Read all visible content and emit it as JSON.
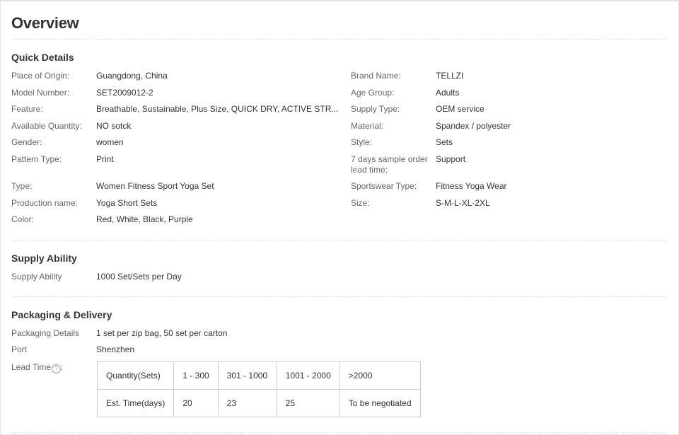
{
  "title": "Overview",
  "quick_details": {
    "heading": "Quick Details",
    "left": [
      {
        "label": "Place of Origin:",
        "value": "Guangdong, China"
      },
      {
        "label": "Model Number:",
        "value": "SET2009012-2"
      },
      {
        "label": "Feature:",
        "value": "Breathable, Sustainable, Plus Size, QUICK DRY, ACTIVE STR..."
      },
      {
        "label": "Available Quantity:",
        "value": "NO sotck"
      },
      {
        "label": "Gender:",
        "value": "women"
      },
      {
        "label": "Pattern Type:",
        "value": "Print"
      },
      {
        "label": "Type:",
        "value": "Women Fitness Sport Yoga Set"
      },
      {
        "label": "Production name:",
        "value": "Yoga Short Sets"
      },
      {
        "label": "Color:",
        "value": "Red, White, Black, Purple"
      }
    ],
    "right": [
      {
        "label": "Brand Name:",
        "value": "TELLZI"
      },
      {
        "label": "Age Group:",
        "value": "Adults"
      },
      {
        "label": "Supply Type:",
        "value": "OEM service"
      },
      {
        "label": "Material:",
        "value": "Spandex / polyester"
      },
      {
        "label": "Style:",
        "value": "Sets"
      },
      {
        "label": "7 days sample order lead time:",
        "value": "Support"
      },
      {
        "label": "Sportswear Type:",
        "value": "Fitness Yoga Wear"
      },
      {
        "label": "Size:",
        "value": "S-M-L-XL-2XL"
      }
    ]
  },
  "supply_ability": {
    "heading": "Supply Ability",
    "label": "Supply Ability",
    "value": "1000 Set/Sets per Day"
  },
  "packaging": {
    "heading": "Packaging & Delivery",
    "details_label": "Packaging Details",
    "details_value": "1 set per zip bag, 50 set per carton",
    "port_label": "Port",
    "port_value": "Shenzhen",
    "lead_label": "Lead Time",
    "lead_suffix": ":",
    "help_icon_glyph": "?",
    "lead_table": {
      "row1": [
        "Quantity(Sets)",
        "1 - 300",
        "301 - 1000",
        "1001 - 2000",
        ">2000"
      ],
      "row2": [
        "Est. Time(days)",
        "20",
        "23",
        "25",
        "To be negotiated"
      ]
    }
  }
}
